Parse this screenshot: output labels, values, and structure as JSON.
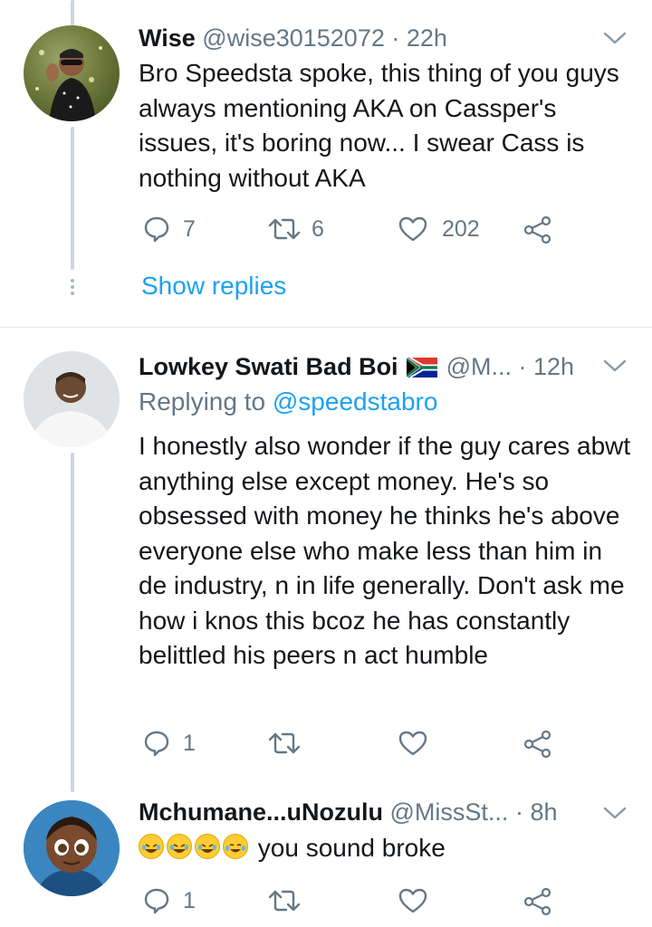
{
  "tweets": [
    {
      "name": "Wise",
      "handle": "@wise30152072",
      "time": "· 22h",
      "text": "Bro Speedsta spoke, this thing of you guys always mentioning AKA on Cassper's issues, it's boring now... I swear Cass is nothing without AKA",
      "reply_count": "7",
      "retweet_count": "6",
      "like_count": "202",
      "show_replies": "Show replies"
    },
    {
      "name": "Lowkey Swati Bad Boi",
      "flag_icon": "south-africa-flag-icon",
      "handle": "@M...",
      "time": "· 12h",
      "replying_prefix": "Replying to",
      "replying_handle": "@speedstabro",
      "text": "I honestly also wonder if the guy cares abwt anything else except money. He's so obsessed with money he thinks he's above everyone else who make less than him in de industry, n in life generally. Don't ask me how i knos this bcoz he has constantly belittled his peers n act humble",
      "reply_count": "1",
      "retweet_count": "",
      "like_count": ""
    },
    {
      "name": "Mchumane...uNozulu",
      "handle": "@MissSt...",
      "time": "· 8h",
      "emoji_icons": [
        "rofl-emoji-icon",
        "rofl-emoji-icon",
        "rofl-emoji-icon",
        "laughing-tears-emoji-icon"
      ],
      "text": "you sound broke",
      "reply_count": "1",
      "retweet_count": "",
      "like_count": ""
    }
  ],
  "colors": {
    "link": "#1da1f2",
    "muted": "#657786",
    "thread_line": "#ccd6dd"
  }
}
